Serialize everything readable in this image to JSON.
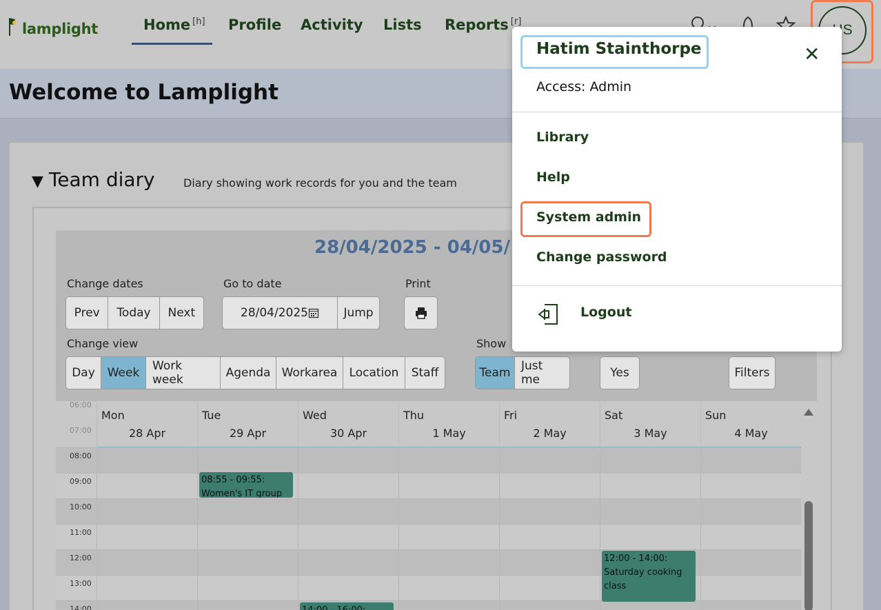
{
  "header": {
    "logo_text": "lamplight",
    "nav": [
      {
        "label": "Home",
        "shortcut": "[h]"
      },
      {
        "label": "Profile"
      },
      {
        "label": "Activity"
      },
      {
        "label": "Lists"
      },
      {
        "label": "Reports",
        "shortcut": "[r]"
      }
    ],
    "search_shortcut": "[ ]",
    "avatar_initials": "HS"
  },
  "page": {
    "title": "Welcome to Lamplight"
  },
  "diary": {
    "toggle": "▼",
    "title": "Team diary",
    "subtitle": "Diary showing work records for you and the team",
    "date_range": "28/04/2025 - 04/05/",
    "change_dates_label": "Change dates",
    "prev": "Prev",
    "today": "Today",
    "next": "Next",
    "go_to_date_label": "Go to date",
    "date_value": "28/04/2025",
    "jump": "Jump",
    "print_label": "Print",
    "change_view_label": "Change view",
    "views": [
      "Day",
      "Week",
      "Work week",
      "Agenda",
      "Workarea",
      "Location",
      "Staff"
    ],
    "active_view": "Week",
    "show_label": "Show",
    "show_options": [
      "Team",
      "Just me"
    ],
    "active_show": "Team",
    "yes": "Yes",
    "filters": "Filters",
    "days": [
      {
        "name": "Mon",
        "date": "28 Apr"
      },
      {
        "name": "Tue",
        "date": "29 Apr"
      },
      {
        "name": "Wed",
        "date": "30 Apr"
      },
      {
        "name": "Thu",
        "date": "1 May"
      },
      {
        "name": "Fri",
        "date": "2 May"
      },
      {
        "name": "Sat",
        "date": "3 May"
      },
      {
        "name": "Sun",
        "date": "4 May"
      }
    ],
    "hours": [
      "06:00",
      "07:00",
      "08:00",
      "09:00",
      "10:00",
      "11:00",
      "12:00",
      "13:00",
      "14:00"
    ],
    "events": [
      {
        "day": "Tue",
        "time": "08:55 - 09:55:",
        "title": "Women's IT group"
      },
      {
        "day": "Sat",
        "time": "12:00 - 14:00:",
        "title": "Saturday cooking class"
      },
      {
        "day": "Wed",
        "time": "14:00 - 16:00:",
        "title": ""
      }
    ]
  },
  "user_menu": {
    "name": "Hatim Stainthorpe",
    "close": "✕",
    "access": "Access: Admin",
    "items": [
      "Library",
      "Help",
      "System admin",
      "Change password"
    ],
    "logout": "Logout"
  }
}
